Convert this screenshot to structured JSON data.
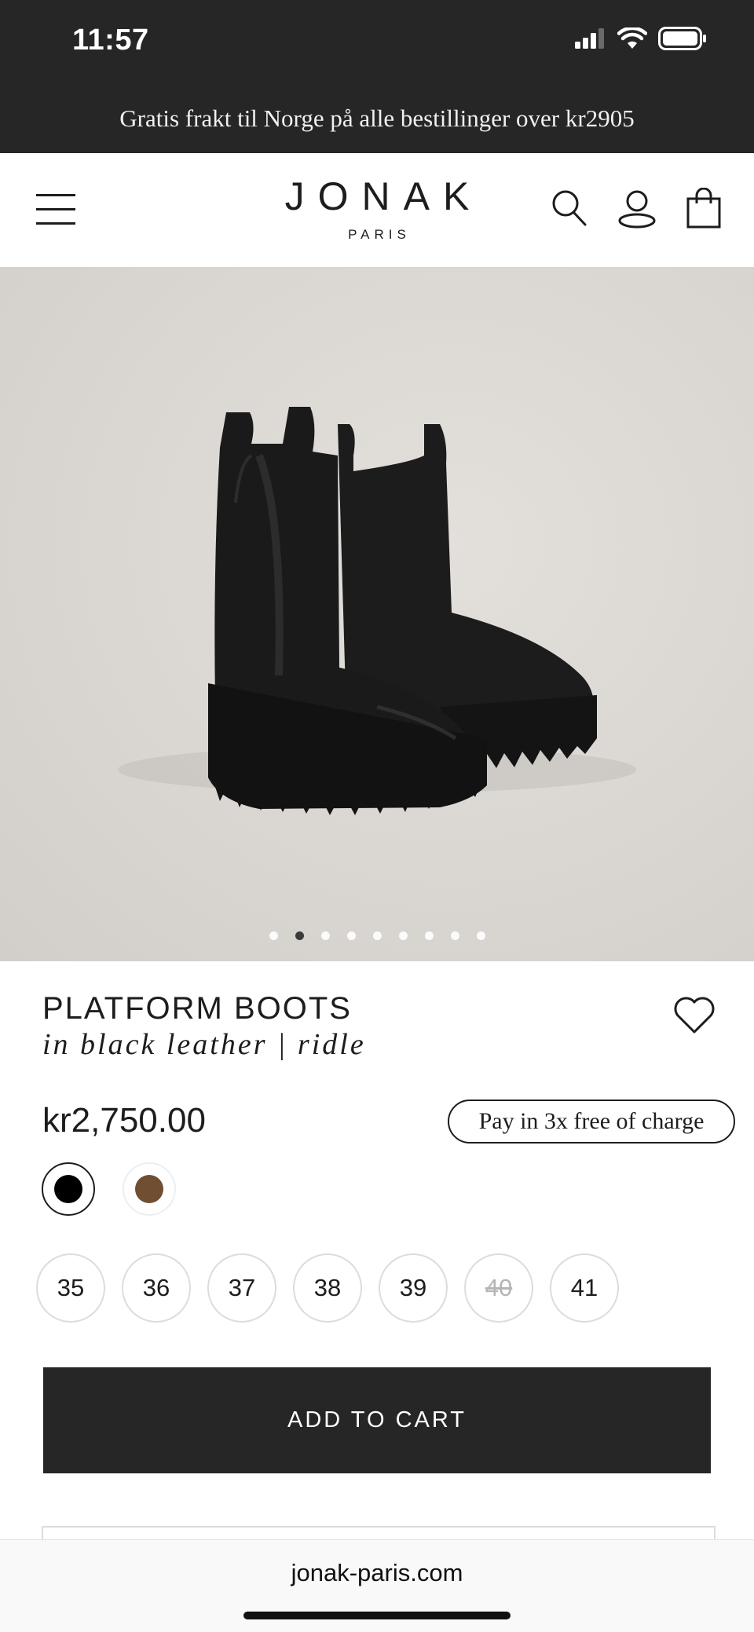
{
  "status_bar": {
    "time": "11:57"
  },
  "promo": {
    "text": "Gratis frakt til Norge på alle bestillinger over kr2905"
  },
  "header": {
    "logo_main": "JONAK",
    "logo_sub": "PARIS",
    "icons": [
      "menu-icon",
      "search-icon",
      "account-icon",
      "cart-icon"
    ]
  },
  "gallery": {
    "total_images": 9,
    "active_index": 2
  },
  "product": {
    "title": "PLATFORM BOOTS",
    "subtitle": "in black leather | ridle",
    "price": "kr2,750.00",
    "pay_label": "Pay in 3x free of charge",
    "colors": [
      {
        "name": "black",
        "hex": "#000000",
        "selected": true
      },
      {
        "name": "brown",
        "hex": "#6f4e31",
        "selected": false
      }
    ],
    "sizes": [
      {
        "label": "35",
        "available": true
      },
      {
        "label": "36",
        "available": true
      },
      {
        "label": "37",
        "available": true
      },
      {
        "label": "38",
        "available": true
      },
      {
        "label": "39",
        "available": true
      },
      {
        "label": "40",
        "available": false
      },
      {
        "label": "41",
        "available": true
      }
    ],
    "add_to_cart": "ADD TO CART"
  },
  "browser": {
    "url": "jonak-paris.com"
  },
  "colors": {
    "dark": "#262626",
    "text": "#1d1d1f",
    "border": "#dcdcdc"
  }
}
